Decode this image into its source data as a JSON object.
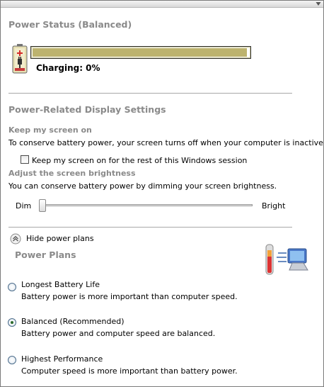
{
  "power_status": {
    "heading": "Power Status (Balanced)",
    "charging_text": "Charging: 0%",
    "charge_fraction": 0.99,
    "bar_color": "#bdb36e"
  },
  "display_settings": {
    "heading": "Power-Related Display Settings",
    "keep_screen_heading": "Keep my screen on",
    "keep_screen_desc": "To conserve battery power, your screen turns off when your computer is inactive.",
    "keep_screen_checkbox_label": "Keep my screen on for the rest of this Windows session",
    "keep_screen_checked": false,
    "brightness_heading": "Adjust the screen brightness",
    "brightness_desc": "You can conserve battery power by dimming your screen brightness.",
    "dim_label": "Dim",
    "bright_label": "Bright",
    "brightness_level": 0.0
  },
  "plans": {
    "toggle_label": "Hide power plans",
    "heading": "Power Plans",
    "items": [
      {
        "title": "Longest Battery Life",
        "desc": "Battery power is more important than computer speed.",
        "selected": false
      },
      {
        "title": "Balanced (Recommended)",
        "desc": "Battery power and computer speed are balanced.",
        "selected": true
      },
      {
        "title": "Highest Performance",
        "desc": "Computer speed is more important than battery power.",
        "selected": false
      }
    ]
  },
  "icons": {
    "battery": "battery-icon",
    "collapse": "chevron-down-icon",
    "toggle": "chevron-up-icon",
    "plans": "power-plans-icon"
  }
}
